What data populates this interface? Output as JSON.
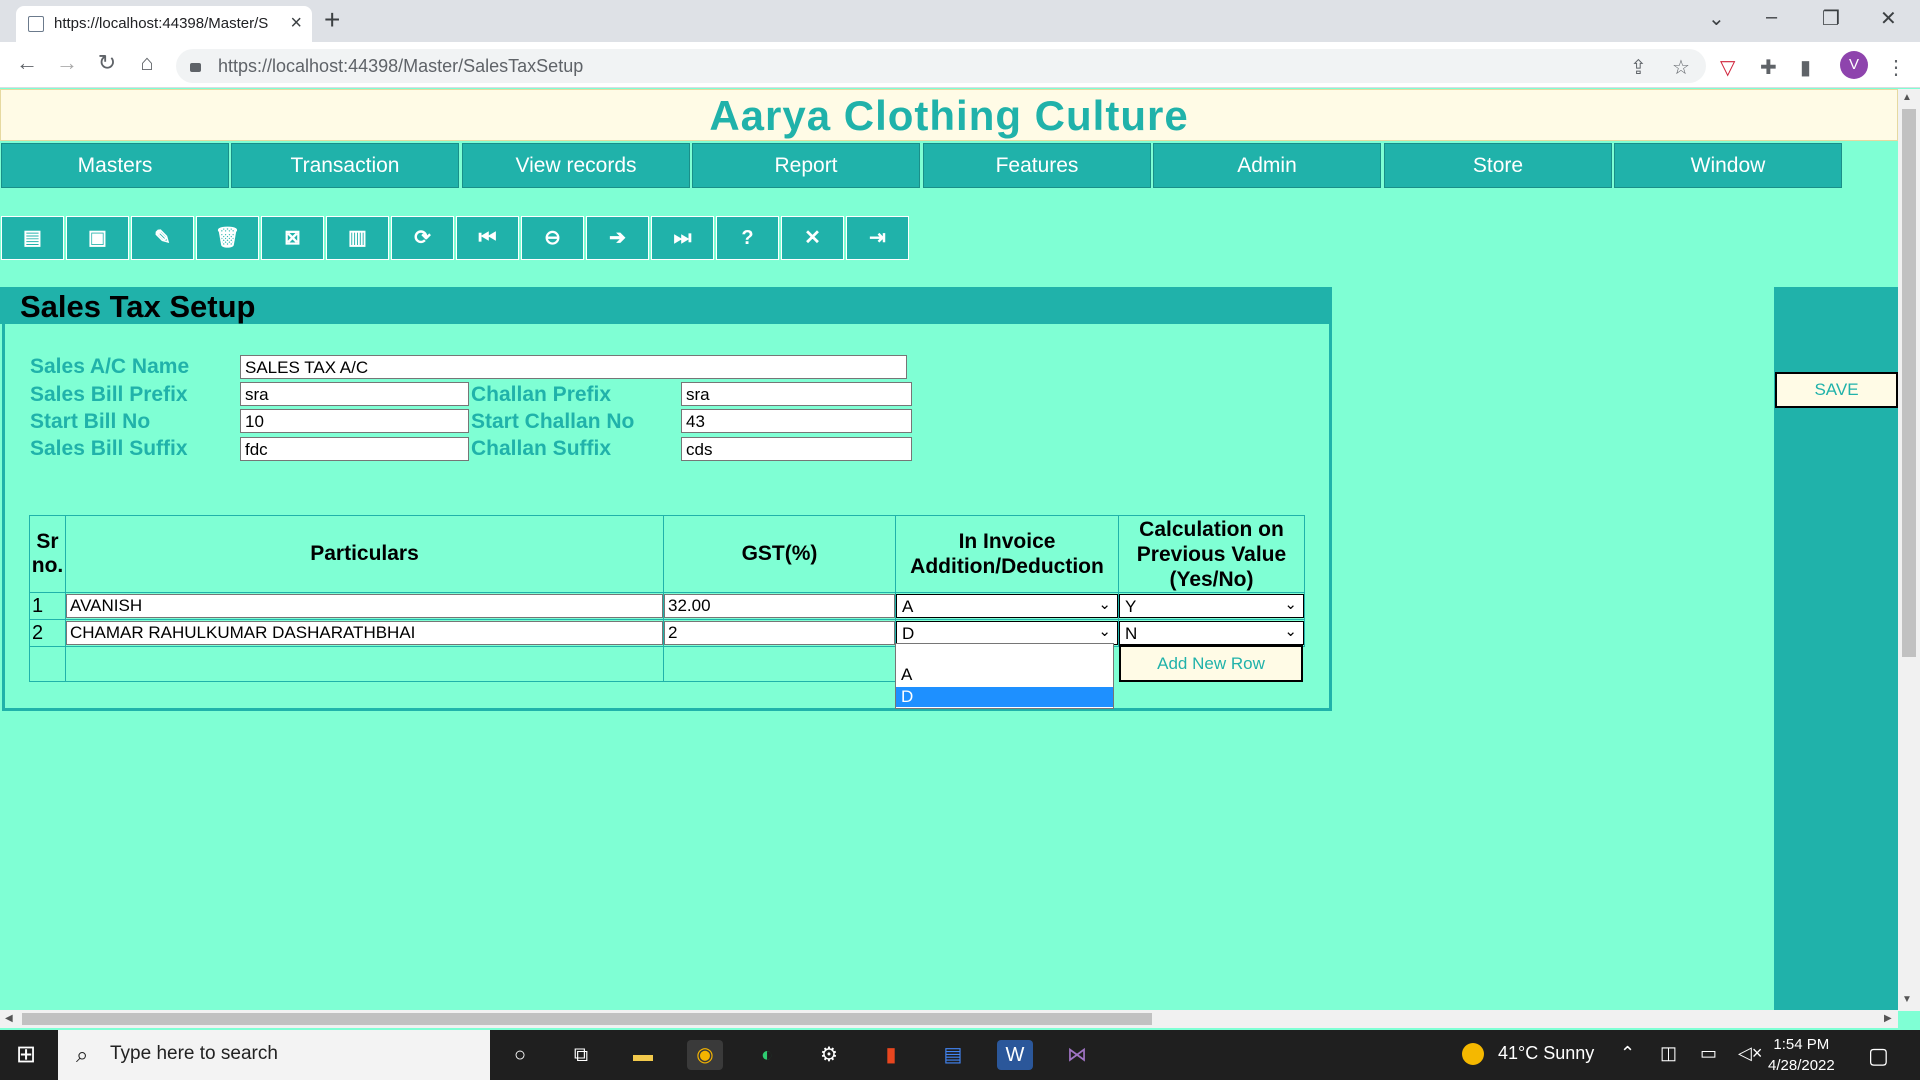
{
  "browser": {
    "tab_title": "https://localhost:44398/Master/S",
    "url": "https://localhost:44398/Master/SalesTaxSetup",
    "profile_initial": "V"
  },
  "app": {
    "title": "Aarya Clothing Culture",
    "menu": [
      "Masters",
      "Transaction",
      "View records",
      "Report",
      "Features",
      "Admin",
      "Store",
      "Window"
    ],
    "toolbar_icons": [
      "new-file-icon",
      "save-icon",
      "edit-icon",
      "delete-icon",
      "cancel-icon",
      "paste-icon",
      "refresh-icon",
      "first-record-icon",
      "previous-icon",
      "next-icon",
      "last-record-icon",
      "help-icon",
      "close-icon",
      "exit-icon"
    ]
  },
  "page": {
    "title": "Sales Tax Setup",
    "save_label": "SAVE"
  },
  "form": {
    "sales_ac_name_label": "Sales A/C Name",
    "sales_ac_name_value": "SALES TAX A/C",
    "sales_bill_prefix_label": "Sales Bill Prefix",
    "sales_bill_prefix_value": "sra",
    "challan_prefix_label": "Challan Prefix",
    "challan_prefix_value": "sra",
    "start_bill_no_label": "Start Bill No",
    "start_bill_no_value": "10",
    "start_challan_no_label": "Start Challan No",
    "start_challan_no_value": "43",
    "sales_bill_suffix_label": "Sales Bill Suffix",
    "sales_bill_suffix_value": "fdc",
    "challan_suffix_label": "Challan Suffix",
    "challan_suffix_value": "cds"
  },
  "table": {
    "headers": {
      "srno_1": "Sr",
      "srno_2": "no.",
      "particulars": "Particulars",
      "gst": "GST(%)",
      "invoice_1": "In Invoice",
      "invoice_2": "Addition/Deduction",
      "calc_1": "Calculation on",
      "calc_2": "Previous Value",
      "calc_3": "(Yes/No)"
    },
    "rows": [
      {
        "sr": "1",
        "particulars": "AVANISH",
        "gst": "32.00",
        "invoice": "A",
        "calc": "Y"
      },
      {
        "sr": "2",
        "particulars": "CHAMAR RAHULKUMAR DASHARATHBHAI",
        "gst": "2",
        "invoice": "D",
        "calc": "N"
      }
    ],
    "dropdown_options": [
      "A",
      "D"
    ],
    "dropdown_selected": "D",
    "add_row_label": "Add New Row"
  },
  "taskbar": {
    "search_placeholder": "Type here to search",
    "weather": "41°C  Sunny",
    "time": "1:54 PM",
    "date": "4/28/2022"
  }
}
